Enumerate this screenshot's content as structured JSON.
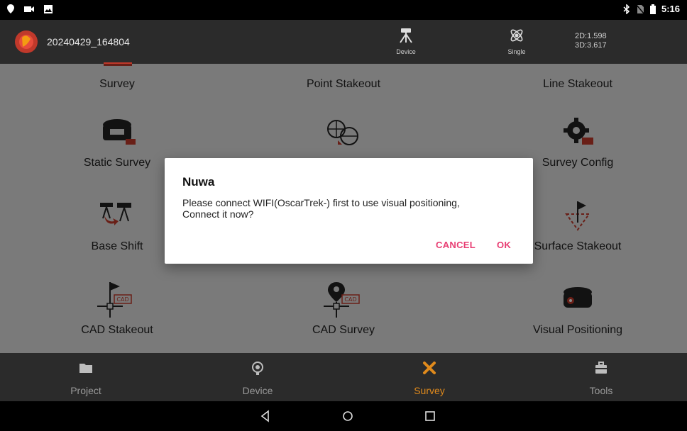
{
  "status_bar": {
    "time": "5:16",
    "left_icons": [
      "location-icon",
      "video-icon",
      "image-icon"
    ],
    "right_icons": [
      "bluetooth-icon",
      "no-sim-icon",
      "battery-icon"
    ]
  },
  "app_bar": {
    "project_name": "20240429_164804",
    "device_label": "Device",
    "mode_label": "Single",
    "precision_2d": "2D:1.598",
    "precision_3d": "3D:3.617"
  },
  "grid": {
    "tiles": [
      {
        "label": "Survey",
        "icon": "survey-icon"
      },
      {
        "label": "Point Stakeout",
        "icon": "point-stakeout-icon"
      },
      {
        "label": "Line Stakeout",
        "icon": "line-stakeout-icon"
      },
      {
        "label": "Static Survey",
        "icon": "receiver-rec-icon"
      },
      {
        "label": "",
        "icon": "globe-transform-icon"
      },
      {
        "label": "Survey Config",
        "icon": "gear-icon"
      },
      {
        "label": "Base Shift",
        "icon": "base-shift-icon"
      },
      {
        "label": "",
        "icon": ""
      },
      {
        "label": "Surface Stakeout",
        "icon": "surface-stakeout-icon"
      },
      {
        "label": "CAD Stakeout",
        "icon": "cad-flag-icon"
      },
      {
        "label": "CAD Survey",
        "icon": "cad-pin-icon"
      },
      {
        "label": "Visual Positioning",
        "icon": "camera-receiver-icon"
      }
    ]
  },
  "dialog": {
    "title": "Nuwa",
    "message_line1": "Please connect WIFI(OscarTrek-) first to use visual positioning,",
    "message_line2": "Connect it now?",
    "cancel_label": "CANCEL",
    "ok_label": "OK"
  },
  "bottom_nav": {
    "items": [
      {
        "label": "Project",
        "icon": "folder-icon"
      },
      {
        "label": "Device",
        "icon": "device-icon"
      },
      {
        "label": "Survey",
        "icon": "survey-tools-icon"
      },
      {
        "label": "Tools",
        "icon": "toolbox-icon"
      }
    ],
    "active": "Survey",
    "active_color": "#e08a1c"
  },
  "colors": {
    "dialog_button": "#e83e73",
    "app_bar_bg": "#2b2b2b",
    "grid_bg": "#dedede"
  }
}
